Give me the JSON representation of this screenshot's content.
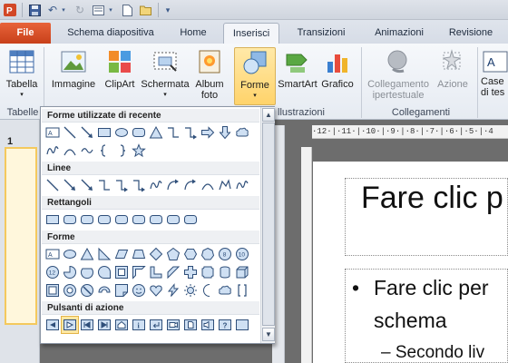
{
  "qat": {
    "icons": [
      "powerpoint-logo-icon",
      "save-icon",
      "undo-icon",
      "redo-icon",
      "layout-icon",
      "new-icon",
      "open-icon",
      "customize-qat-icon"
    ]
  },
  "tabs": [
    {
      "label": "File",
      "key": "file"
    },
    {
      "label": "Schema diapositiva",
      "key": "schema"
    },
    {
      "label": "Home",
      "key": "home"
    },
    {
      "label": "Inserisci",
      "key": "inserisci"
    },
    {
      "label": "Transizioni",
      "key": "transizioni"
    },
    {
      "label": "Animazioni",
      "key": "animazioni"
    },
    {
      "label": "Revisione",
      "key": "revisione"
    }
  ],
  "ribbon": {
    "tabella": "Tabella",
    "immagine": "Immagine",
    "clipart": "ClipArt",
    "schermata": "Schermata",
    "album_1": "Album",
    "album_2": "foto",
    "forme": "Forme",
    "smartart": "SmartArt",
    "grafico": "Grafico",
    "collegamento_1": "Collegamento",
    "collegamento_2": "ipertestuale",
    "azione": "Azione",
    "casella_1": "Case",
    "casella_2": "di tes",
    "groups": {
      "tabelle": "Tabelle",
      "illustrazioni": "llustrazioni",
      "collegamenti": "Collegamenti"
    }
  },
  "gallery": {
    "recent": "Forme utilizzate di recente",
    "linee": "Linee",
    "rettangoli": "Rettangoli",
    "forme": "Forme",
    "pulsanti": "Pulsanti di azione"
  },
  "thumbs": {
    "number": "1"
  },
  "ruler": "·12·|·11·|·10·|·9·|·8·|·7·|·6·|·5·|·4",
  "slide": {
    "title": "Fare clic p",
    "bullet1": "Fare clic per",
    "bullet2": "schema",
    "bullet3": "– Secondo liv"
  },
  "colors": {
    "file_tab": "#d9522a",
    "accent": "#ffd36b"
  }
}
